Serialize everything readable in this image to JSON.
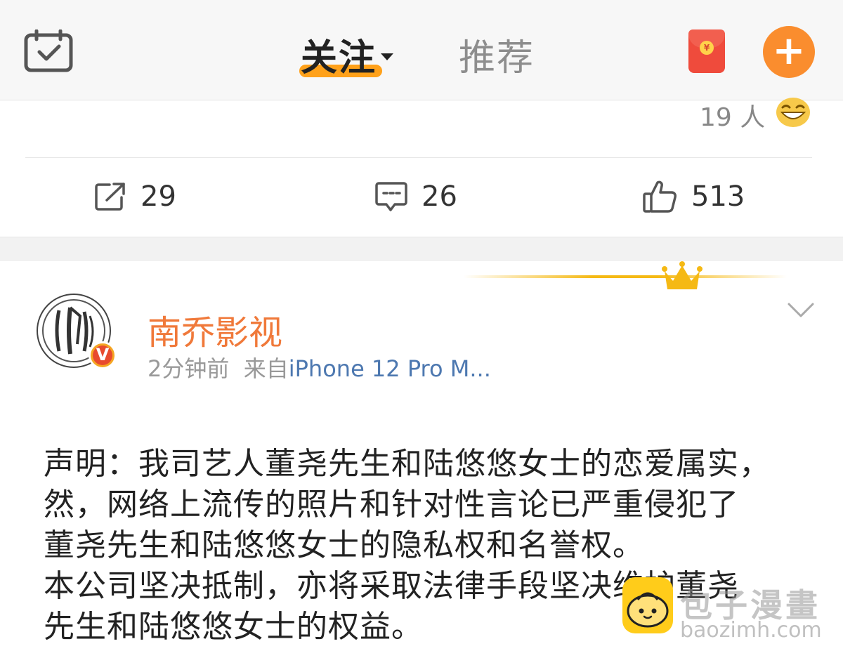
{
  "header": {
    "tabs": [
      {
        "label": "关注",
        "active": true,
        "has_dropdown": true
      },
      {
        "label": "推荐",
        "active": false
      }
    ],
    "left_icon": "calendar-check-icon",
    "right_icons": [
      "red-packet-icon",
      "plus-icon"
    ],
    "red_packet_symbol": "¥",
    "plus_symbol": "+",
    "accent_color": "#ffa11a"
  },
  "previous_post": {
    "reaction_count": "19 人",
    "reaction_emoji": "laughing-emoji-icon",
    "actions": [
      {
        "icon": "repost-icon",
        "count": "29"
      },
      {
        "icon": "comment-icon",
        "count": "26"
      },
      {
        "icon": "like-icon",
        "count": "513"
      }
    ]
  },
  "post": {
    "author": "南乔影视",
    "verified_badge": "V",
    "time": "2分钟前",
    "source_prefix": "来自",
    "source": "iPhone 12 Pro M...",
    "author_color": "#f0793a",
    "body": [
      "声明：我司艺人董尧先生和陆悠悠女士的恋爱属实，",
      "然，网络上流传的照片和针对性言论已严重侵犯了",
      "董尧先生和陆悠悠女士的隐私权和名誉权。",
      "本公司坚决抵制，亦将采取法律手段坚决维护董尧",
      "先生和陆悠悠女士的权益。"
    ]
  },
  "watermark": {
    "text": "包子漫畫",
    "url": "baozimh.com"
  }
}
